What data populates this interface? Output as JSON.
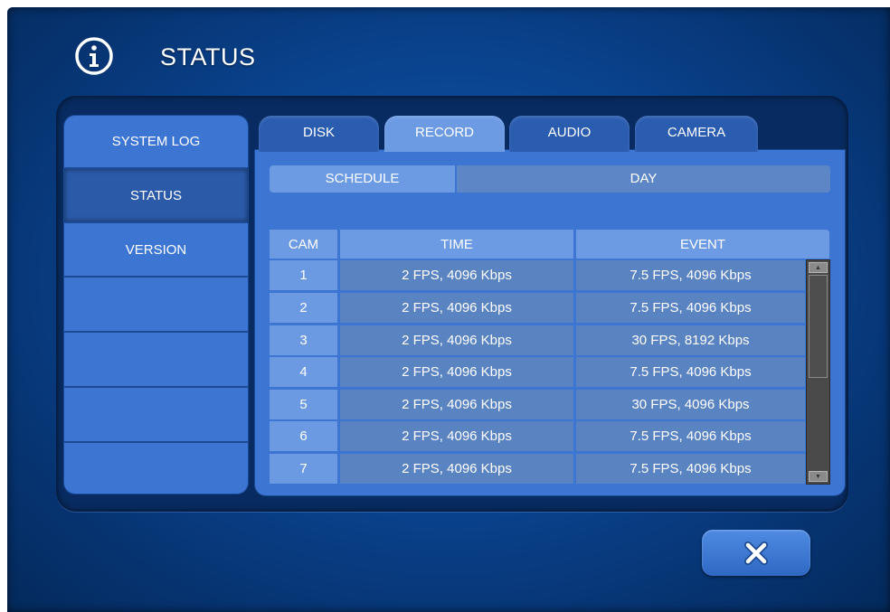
{
  "title": {
    "text": "STATUS",
    "icon": "info-circle-icon"
  },
  "sidebar": {
    "items": [
      {
        "label": "SYSTEM LOG"
      },
      {
        "label": "STATUS",
        "active": true
      },
      {
        "label": "VERSION"
      },
      {
        "label": ""
      },
      {
        "label": ""
      },
      {
        "label": ""
      },
      {
        "label": ""
      }
    ]
  },
  "tabs": [
    {
      "label": "DISK"
    },
    {
      "label": "RECORD",
      "active": true
    },
    {
      "label": "AUDIO"
    },
    {
      "label": "CAMERA"
    }
  ],
  "subtabs": {
    "schedule": "SCHEDULE",
    "day": "DAY"
  },
  "table": {
    "headers": {
      "cam": "CAM",
      "time": "TIME",
      "event": "EVENT"
    },
    "rows": [
      {
        "cam": "1",
        "time": "2 FPS, 4096 Kbps",
        "event": "7.5 FPS, 4096 Kbps"
      },
      {
        "cam": "2",
        "time": "2 FPS, 4096 Kbps",
        "event": "7.5 FPS, 4096 Kbps"
      },
      {
        "cam": "3",
        "time": "2 FPS, 4096 Kbps",
        "event": "30 FPS, 8192 Kbps"
      },
      {
        "cam": "4",
        "time": "2 FPS, 4096 Kbps",
        "event": "7.5 FPS, 4096 Kbps"
      },
      {
        "cam": "5",
        "time": "2 FPS, 4096 Kbps",
        "event": "30 FPS, 4096 Kbps"
      },
      {
        "cam": "6",
        "time": "2 FPS, 4096 Kbps",
        "event": "7.5 FPS, 4096 Kbps"
      },
      {
        "cam": "7",
        "time": "2 FPS, 4096 Kbps",
        "event": "7.5 FPS, 4096 Kbps"
      }
    ]
  },
  "colors": {
    "background": "#0a4490",
    "panel": "#082c62",
    "active_tab": "#6c9be4",
    "inactive_tab": "#2a5cb0",
    "cell": "#5a83c2"
  },
  "close_button": {
    "icon": "close-x-icon"
  }
}
